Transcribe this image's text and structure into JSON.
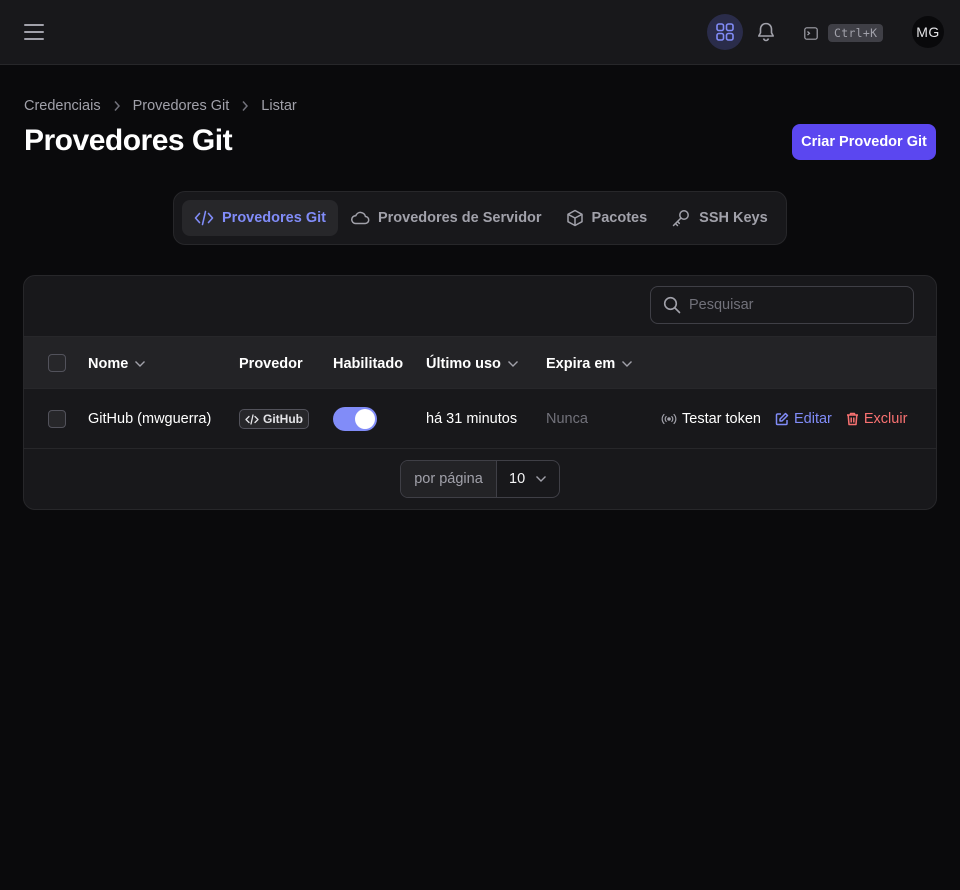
{
  "topbar": {
    "menu_icon": "hamburger-icon",
    "apps_icon": "grid-icon",
    "notifications_icon": "bell-icon",
    "command_icon": "terminal-icon",
    "command_shortcut": "Ctrl+K",
    "avatar_initials": "MG"
  },
  "breadcrumb": {
    "items": [
      "Credenciais",
      "Provedores Git",
      "Listar"
    ]
  },
  "page": {
    "title": "Provedores Git",
    "create_button": "Criar Provedor Git"
  },
  "tabs": [
    {
      "label": "Provedores Git",
      "icon": "code-icon",
      "active": true
    },
    {
      "label": "Provedores de Servidor",
      "icon": "cloud-icon",
      "active": false
    },
    {
      "label": "Pacotes",
      "icon": "cube-icon",
      "active": false
    },
    {
      "label": "SSH Keys",
      "icon": "key-icon",
      "active": false
    }
  ],
  "table": {
    "search_placeholder": "Pesquisar",
    "columns": [
      "Nome",
      "Provedor",
      "Habilitado",
      "Último uso",
      "Expira em"
    ],
    "rows": [
      {
        "name": "GitHub (mwguerra)",
        "provider": "GitHub",
        "enabled": true,
        "last_used": "há 31 minutos",
        "expires": "Nunca",
        "actions": {
          "test": "Testar token",
          "edit": "Editar",
          "delete": "Excluir"
        }
      }
    ],
    "pagination": {
      "per_page_label": "por página",
      "per_page_value": "10"
    }
  },
  "colors": {
    "accent": "#818cf8",
    "primary_button": "#5b47f0",
    "danger": "#f87171",
    "background": "#0a0a0c"
  }
}
